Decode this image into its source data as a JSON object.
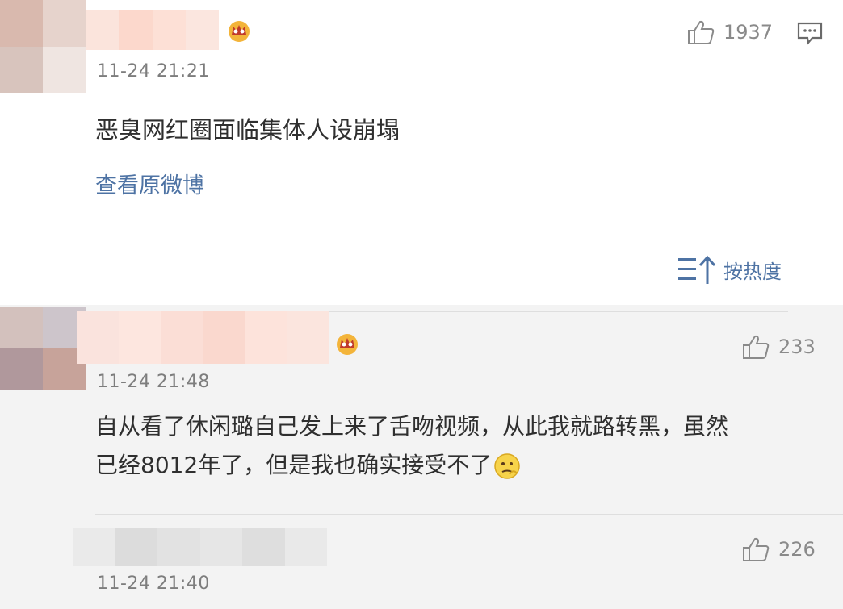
{
  "original_post": {
    "timestamp": "11-24 21:21",
    "like_count": "1937",
    "text": "恶臭网红圈面临集体人设崩塌",
    "view_original_link": "查看原微博",
    "comment_icon": "comment-icon"
  },
  "sort": {
    "label": "按热度",
    "icon": "sort-icon"
  },
  "comments": [
    {
      "timestamp": "11-24 21:48",
      "like_count": "233",
      "text_line1": "自从看了休闲璐自己发上来了舌吻视频，从此我就路转黑，虽然",
      "text_line2": "已经8012年了，但是我也确实接受不了",
      "emoji": "thinking-emoji"
    },
    {
      "timestamp": "11-24 21:40",
      "like_count": "226"
    }
  ],
  "colors": {
    "link": "#4e73a4",
    "crown": "#e8a21c",
    "background": "#f3f3f3"
  }
}
